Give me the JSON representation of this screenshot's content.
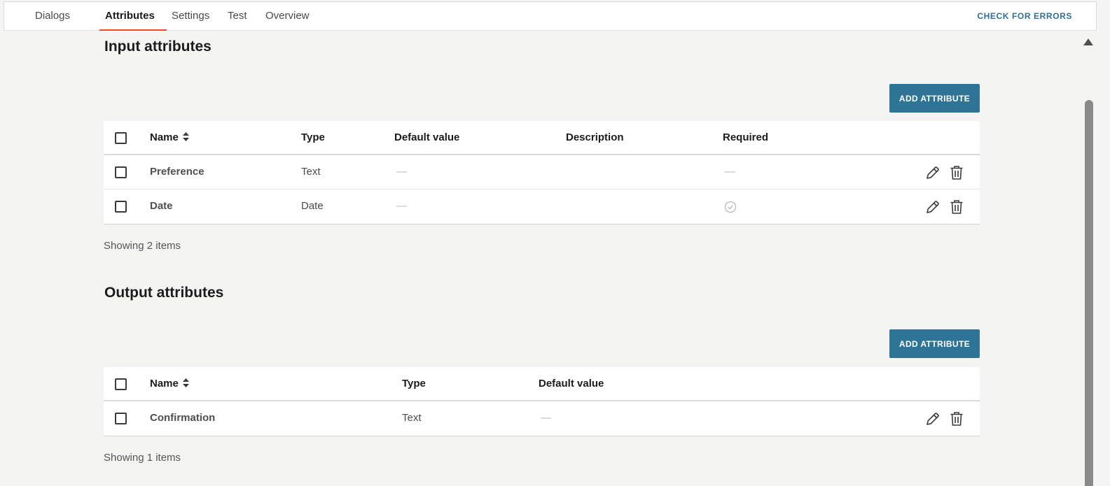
{
  "tabs": [
    {
      "label": "Dialogs"
    },
    {
      "label": "Attributes"
    },
    {
      "label": "Settings"
    },
    {
      "label": "Test"
    },
    {
      "label": "Overview"
    }
  ],
  "active_tab": "Attributes",
  "check_errors_label": "CHECK FOR ERRORS",
  "input": {
    "title": "Input attributes",
    "add_label": "ADD ATTRIBUTE",
    "columns": {
      "name": "Name",
      "type": "Type",
      "default": "Default value",
      "description": "Description",
      "required": "Required"
    },
    "rows": [
      {
        "name": "Preference",
        "type": "Text",
        "default": "—",
        "description": "",
        "required": "—"
      },
      {
        "name": "Date",
        "type": "Date",
        "default": "—",
        "description": "",
        "required_icon": "check-circle-icon"
      }
    ],
    "showing": "Showing 2 items"
  },
  "output": {
    "title": "Output attributes",
    "add_label": "ADD ATTRIBUTE",
    "columns": {
      "name": "Name",
      "type": "Type",
      "default": "Default value"
    },
    "rows": [
      {
        "name": "Confirmation",
        "type": "Text",
        "default": "—"
      }
    ],
    "showing": "Showing 1 items"
  },
  "colors": {
    "accent": "#ef4b2b",
    "primary_button": "#2d7496",
    "link": "#2e7094",
    "background": "#f4f4f3"
  }
}
